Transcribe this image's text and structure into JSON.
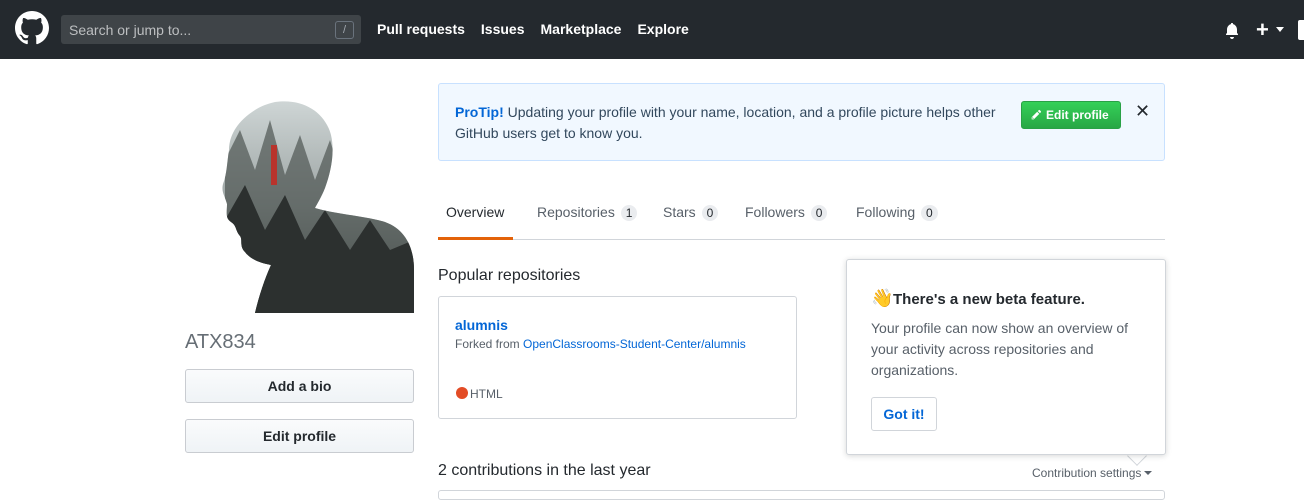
{
  "header": {
    "search_placeholder": "Search or jump to...",
    "search_shortcut": "/",
    "nav": [
      "Pull requests",
      "Issues",
      "Marketplace",
      "Explore"
    ],
    "plus": "+"
  },
  "profile": {
    "username": "ATX834",
    "add_bio_label": "Add a bio",
    "edit_profile_label": "Edit profile"
  },
  "protip": {
    "lead": "ProTip!",
    "text": " Updating your profile with your name, location, and a profile picture helps other GitHub users get to know you.",
    "button_label": "Edit profile",
    "close": "✕"
  },
  "tabs": [
    {
      "label": "Overview",
      "count": null
    },
    {
      "label": "Repositories",
      "count": "1"
    },
    {
      "label": "Stars",
      "count": "0"
    },
    {
      "label": "Followers",
      "count": "0"
    },
    {
      "label": "Following",
      "count": "0"
    }
  ],
  "popular": {
    "heading": "Popular repositories",
    "repo_name": "alumnis",
    "forked_prefix": "Forked from ",
    "forked_link": "OpenClassrooms-Student-Center/alumnis",
    "language": "HTML",
    "language_color": "#e34c26"
  },
  "contributions": {
    "heading": "2 contributions in the last year",
    "settings_label": "Contribution settings"
  },
  "beta": {
    "emoji": "👋",
    "title": "There's a new beta feature.",
    "body": "Your profile can now show an overview of your activity across repositories and organizations.",
    "button_label": "Got it!"
  },
  "colors": {
    "header_bg": "#24292e",
    "link": "#0366d6",
    "accent_tab": "#e36209",
    "green_button": "#28a745"
  }
}
